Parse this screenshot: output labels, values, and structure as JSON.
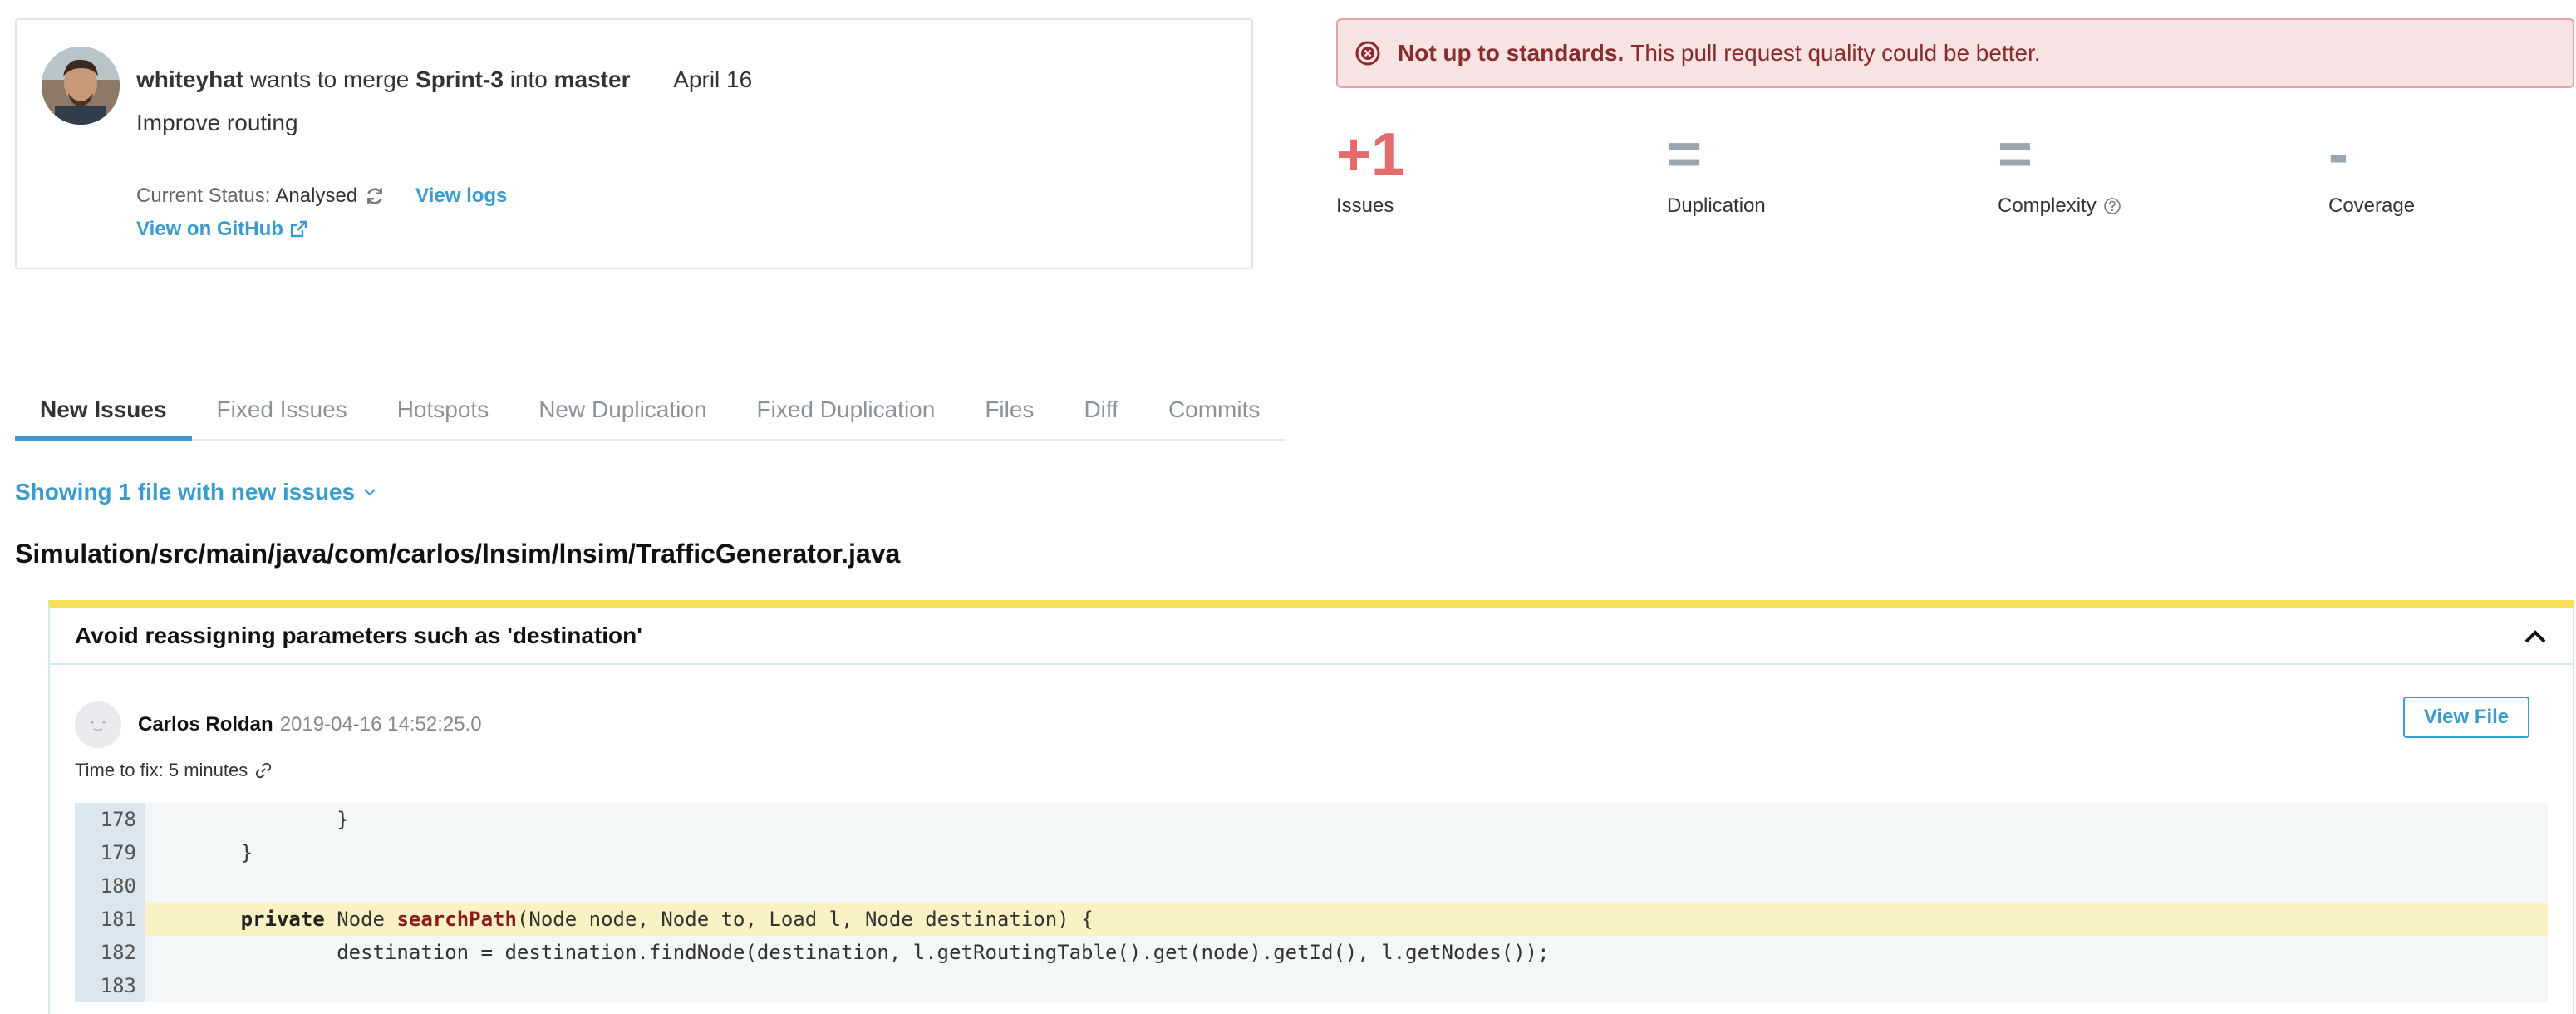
{
  "pull_request": {
    "author": "whiteyhat",
    "action_text": "wants to merge",
    "source_branch": "Sprint-3",
    "into_text": "into",
    "target_branch": "master",
    "date": "April 16",
    "title": "Improve routing",
    "status_label": "Current Status:",
    "status_value": "Analysed",
    "view_logs_label": "View logs",
    "view_github_label": "View on GitHub"
  },
  "alert": {
    "heading": "Not up to standards.",
    "message": "This pull request quality could be better."
  },
  "metrics": [
    {
      "value": "+1",
      "label": "Issues"
    },
    {
      "value": "=",
      "label": "Duplication"
    },
    {
      "value": "=",
      "label": "Complexity"
    },
    {
      "value": "-",
      "label": "Coverage"
    }
  ],
  "tabs": [
    {
      "label": "New Issues"
    },
    {
      "label": "Fixed Issues"
    },
    {
      "label": "Hotspots"
    },
    {
      "label": "New Duplication"
    },
    {
      "label": "Fixed Duplication"
    },
    {
      "label": "Files"
    },
    {
      "label": "Diff"
    },
    {
      "label": "Commits"
    }
  ],
  "active_tab": "New Issues",
  "showing_label": "Showing 1 file with new issues",
  "file_path": "Simulation/src/main/java/com/carlos/lnsim/lnsim/TrafficGenerator.java",
  "issue": {
    "title": "Avoid reassigning parameters such as 'destination'",
    "author": "Carlos Roldan",
    "timestamp": "2019-04-16 14:52:25.0",
    "view_file_label": "View File",
    "time_to_fix": "Time to fix: 5 minutes",
    "code_lines": [
      {
        "no": "178",
        "code": "                }"
      },
      {
        "no": "179",
        "code": "        }"
      },
      {
        "no": "180",
        "code": ""
      },
      {
        "no": "181",
        "code": "        private Node searchPath(Node node, Node to, Load l, Node destination) {"
      },
      {
        "no": "182",
        "code": "                destination = destination.findNode(destination, l.getRoutingTable().get(node).getId(), l.getNodes());"
      },
      {
        "no": "183",
        "code": ""
      }
    ],
    "highlight_line": "181"
  },
  "colors": {
    "accent": "#3a9bcc",
    "alert_bg": "#f7e3e3",
    "alert_text": "#8a2b2b",
    "issue_marker": "#f5e05a",
    "bad_metric": "#e46b6b"
  }
}
